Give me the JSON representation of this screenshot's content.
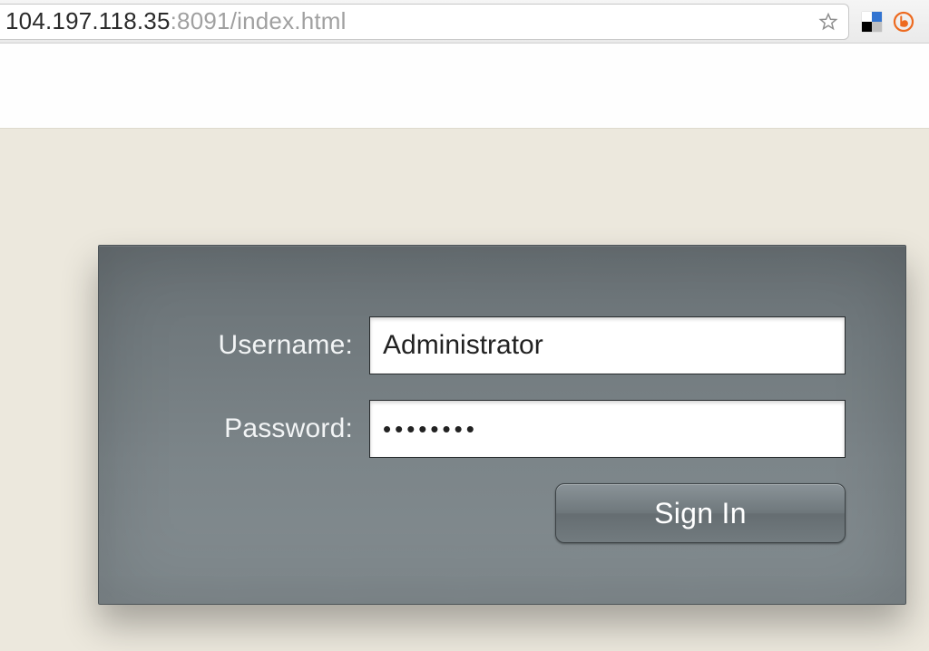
{
  "browser": {
    "url_host": "104.197.118.35",
    "url_port": ":8091",
    "url_path": "/index.html"
  },
  "login": {
    "username_label": "Username:",
    "password_label": "Password:",
    "username_value": "Administrator",
    "password_value": "••••••••",
    "signin_label": "Sign In"
  }
}
